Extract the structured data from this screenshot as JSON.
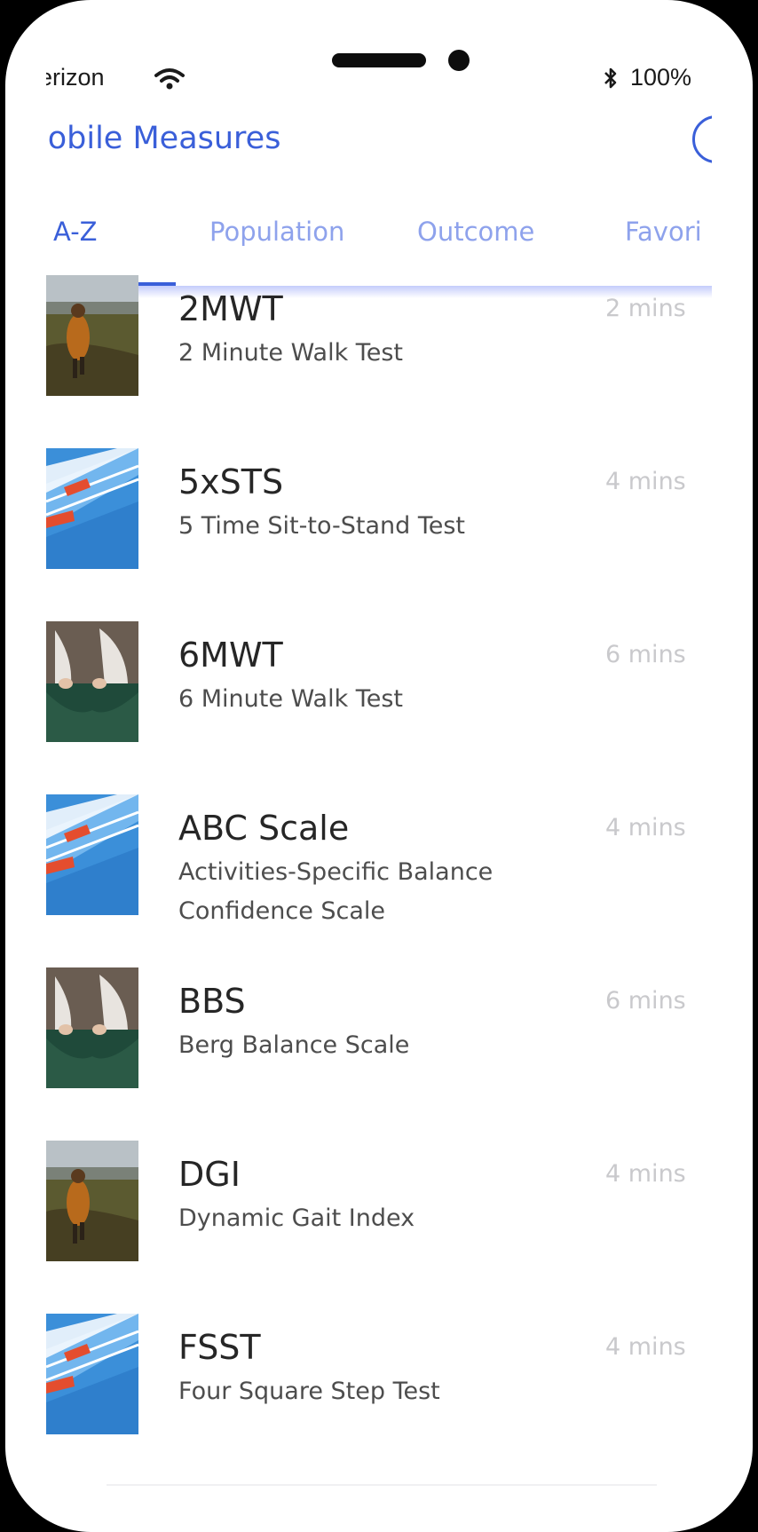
{
  "status_bar": {
    "carrier": "erizon",
    "battery": "100%"
  },
  "header": {
    "title": "lobile Measures"
  },
  "tabs": [
    {
      "label": "A-Z",
      "active": true
    },
    {
      "label": "Population",
      "active": false
    },
    {
      "label": "Outcome",
      "active": false
    },
    {
      "label": "Favori",
      "active": false
    }
  ],
  "measures": [
    {
      "abbr": "2MWT",
      "name": "2 Minute Walk Test",
      "duration": "2 mins",
      "image": "walking-field-photo"
    },
    {
      "abbr": "5xSTS",
      "name": "5 Time Sit-to-Stand Test",
      "duration": "4 mins",
      "image": "stairs-sneakers-photo"
    },
    {
      "abbr": "6MWT",
      "name": "6 Minute Walk Test",
      "duration": "6 mins",
      "image": "seated-feet-photo"
    },
    {
      "abbr": "ABC Scale",
      "name": "Activities-Specific Balance Confidence Scale",
      "duration": "4 mins",
      "image": "stairs-sneakers-photo"
    },
    {
      "abbr": "BBS",
      "name": "Berg Balance Scale",
      "duration": "6 mins",
      "image": "seated-feet-photo"
    },
    {
      "abbr": "DGI",
      "name": "Dynamic Gait Index",
      "duration": "4 mins",
      "image": "walking-field-photo"
    },
    {
      "abbr": "FSST",
      "name": "Four Square Step Test",
      "duration": "4 mins",
      "image": "stairs-sneakers-photo"
    }
  ],
  "colors": {
    "accent": "#3a5fd9",
    "tab_inactive": "#8ea2ec",
    "duration_text": "#c9c9cc"
  }
}
